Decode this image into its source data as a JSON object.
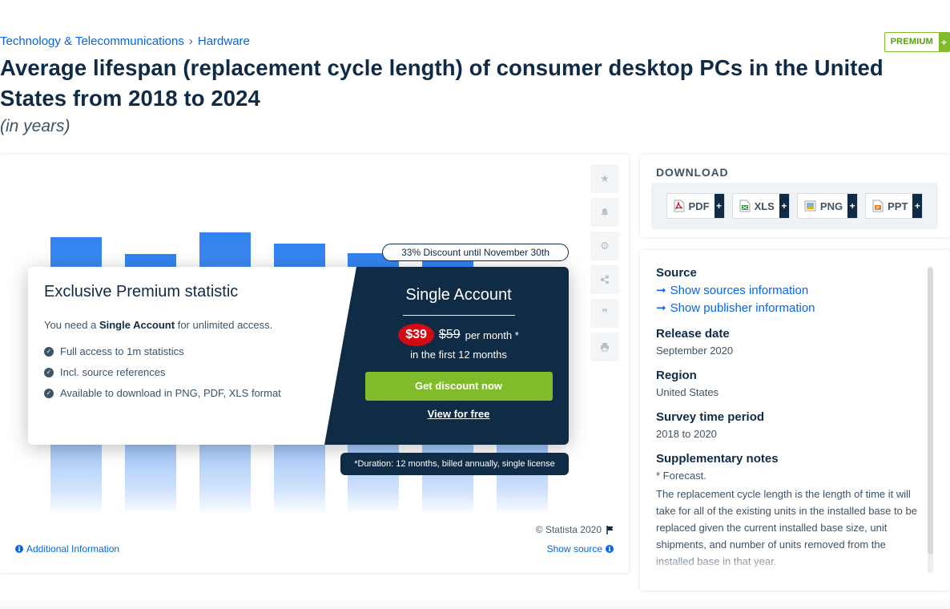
{
  "breadcrumb": {
    "category": "Technology & Telecommunications",
    "separator": "›",
    "subcategory": "Hardware"
  },
  "premium_badge": {
    "label": "PREMIUM",
    "plus": "+"
  },
  "title": "Average lifespan (replacement cycle length) of consumer desktop PCs in the United States from 2018 to 2024",
  "subtitle": "(in years)",
  "chart_data": {
    "type": "bar",
    "bar_count": 7,
    "note": "Values obscured by premium overlay"
  },
  "tools": [
    "star-icon",
    "bell-icon",
    "gear-icon",
    "share-icon",
    "quote-icon",
    "print-icon"
  ],
  "chart_footer": {
    "copyright": "© Statista 2020",
    "additional_info": "Additional Information",
    "show_source": "Show source"
  },
  "paywall": {
    "left_title": "Exclusive Premium statistic",
    "need_prefix": "You need a",
    "need_account": "Single Account",
    "need_suffix": "for unlimited access.",
    "features": [
      "Full access to 1m statistics",
      "Incl. source references",
      "Available to download in PNG, PDF, XLS format"
    ],
    "right_title": "Single Account",
    "price_new": "$39",
    "price_old": "$59",
    "per_month": "per month *",
    "in_first": "in the first 12 months",
    "cta": "Get discount now",
    "view_free": "View for free",
    "discount": "33% Discount until November 30th",
    "duration": "*Duration: 12 months, billed annually, single license"
  },
  "download": {
    "title": "DOWNLOAD",
    "formats": [
      {
        "label": "PDF",
        "color": "#d20a11"
      },
      {
        "label": "XLS",
        "color": "#2e9b3d"
      },
      {
        "label": "PNG",
        "color": "#3a7bd5"
      },
      {
        "label": "PPT",
        "color": "#e97b1b"
      }
    ]
  },
  "source": {
    "source_heading": "Source",
    "show_sources": "Show sources information",
    "show_publisher": "Show publisher information",
    "release_heading": "Release date",
    "release_value": "September 2020",
    "region_heading": "Region",
    "region_value": "United States",
    "survey_heading": "Survey time period",
    "survey_value": "2018 to 2020",
    "notes_heading": "Supplementary notes",
    "notes_forecast": "* Forecast.",
    "notes_text": "The replacement cycle length is the length of time it will take for all of the existing units in the installed base to be replaced given the current installed base size, unit shipments, and number of units removed from the installed base in that year."
  }
}
